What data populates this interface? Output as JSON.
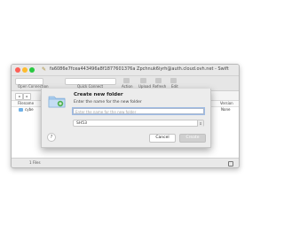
{
  "window": {
    "title": "fa6086e7fcea443496a8f1877601376a Zpchnuk6iyrh@auth.cloud.ovh.net - Swift"
  },
  "toolbar": {
    "open_connection": "Open Connection",
    "quick_connect": "Quick Connect",
    "action": "Action",
    "upload": "Upload",
    "refresh": "Refresh",
    "edit": "Edit"
  },
  "browser": {
    "column_filename": "Filename",
    "column_version": "Version",
    "row_name": "cybe",
    "row_value": "None"
  },
  "status": {
    "file_count": "1 Files"
  },
  "dialog": {
    "title": "Create new folder",
    "subtitle": "Enter the name for the new folder",
    "input_placeholder": "Enter the name for the new folder",
    "container_value": "SH53",
    "help_label": "?",
    "cancel_label": "Cancel",
    "create_label": "Create"
  }
}
